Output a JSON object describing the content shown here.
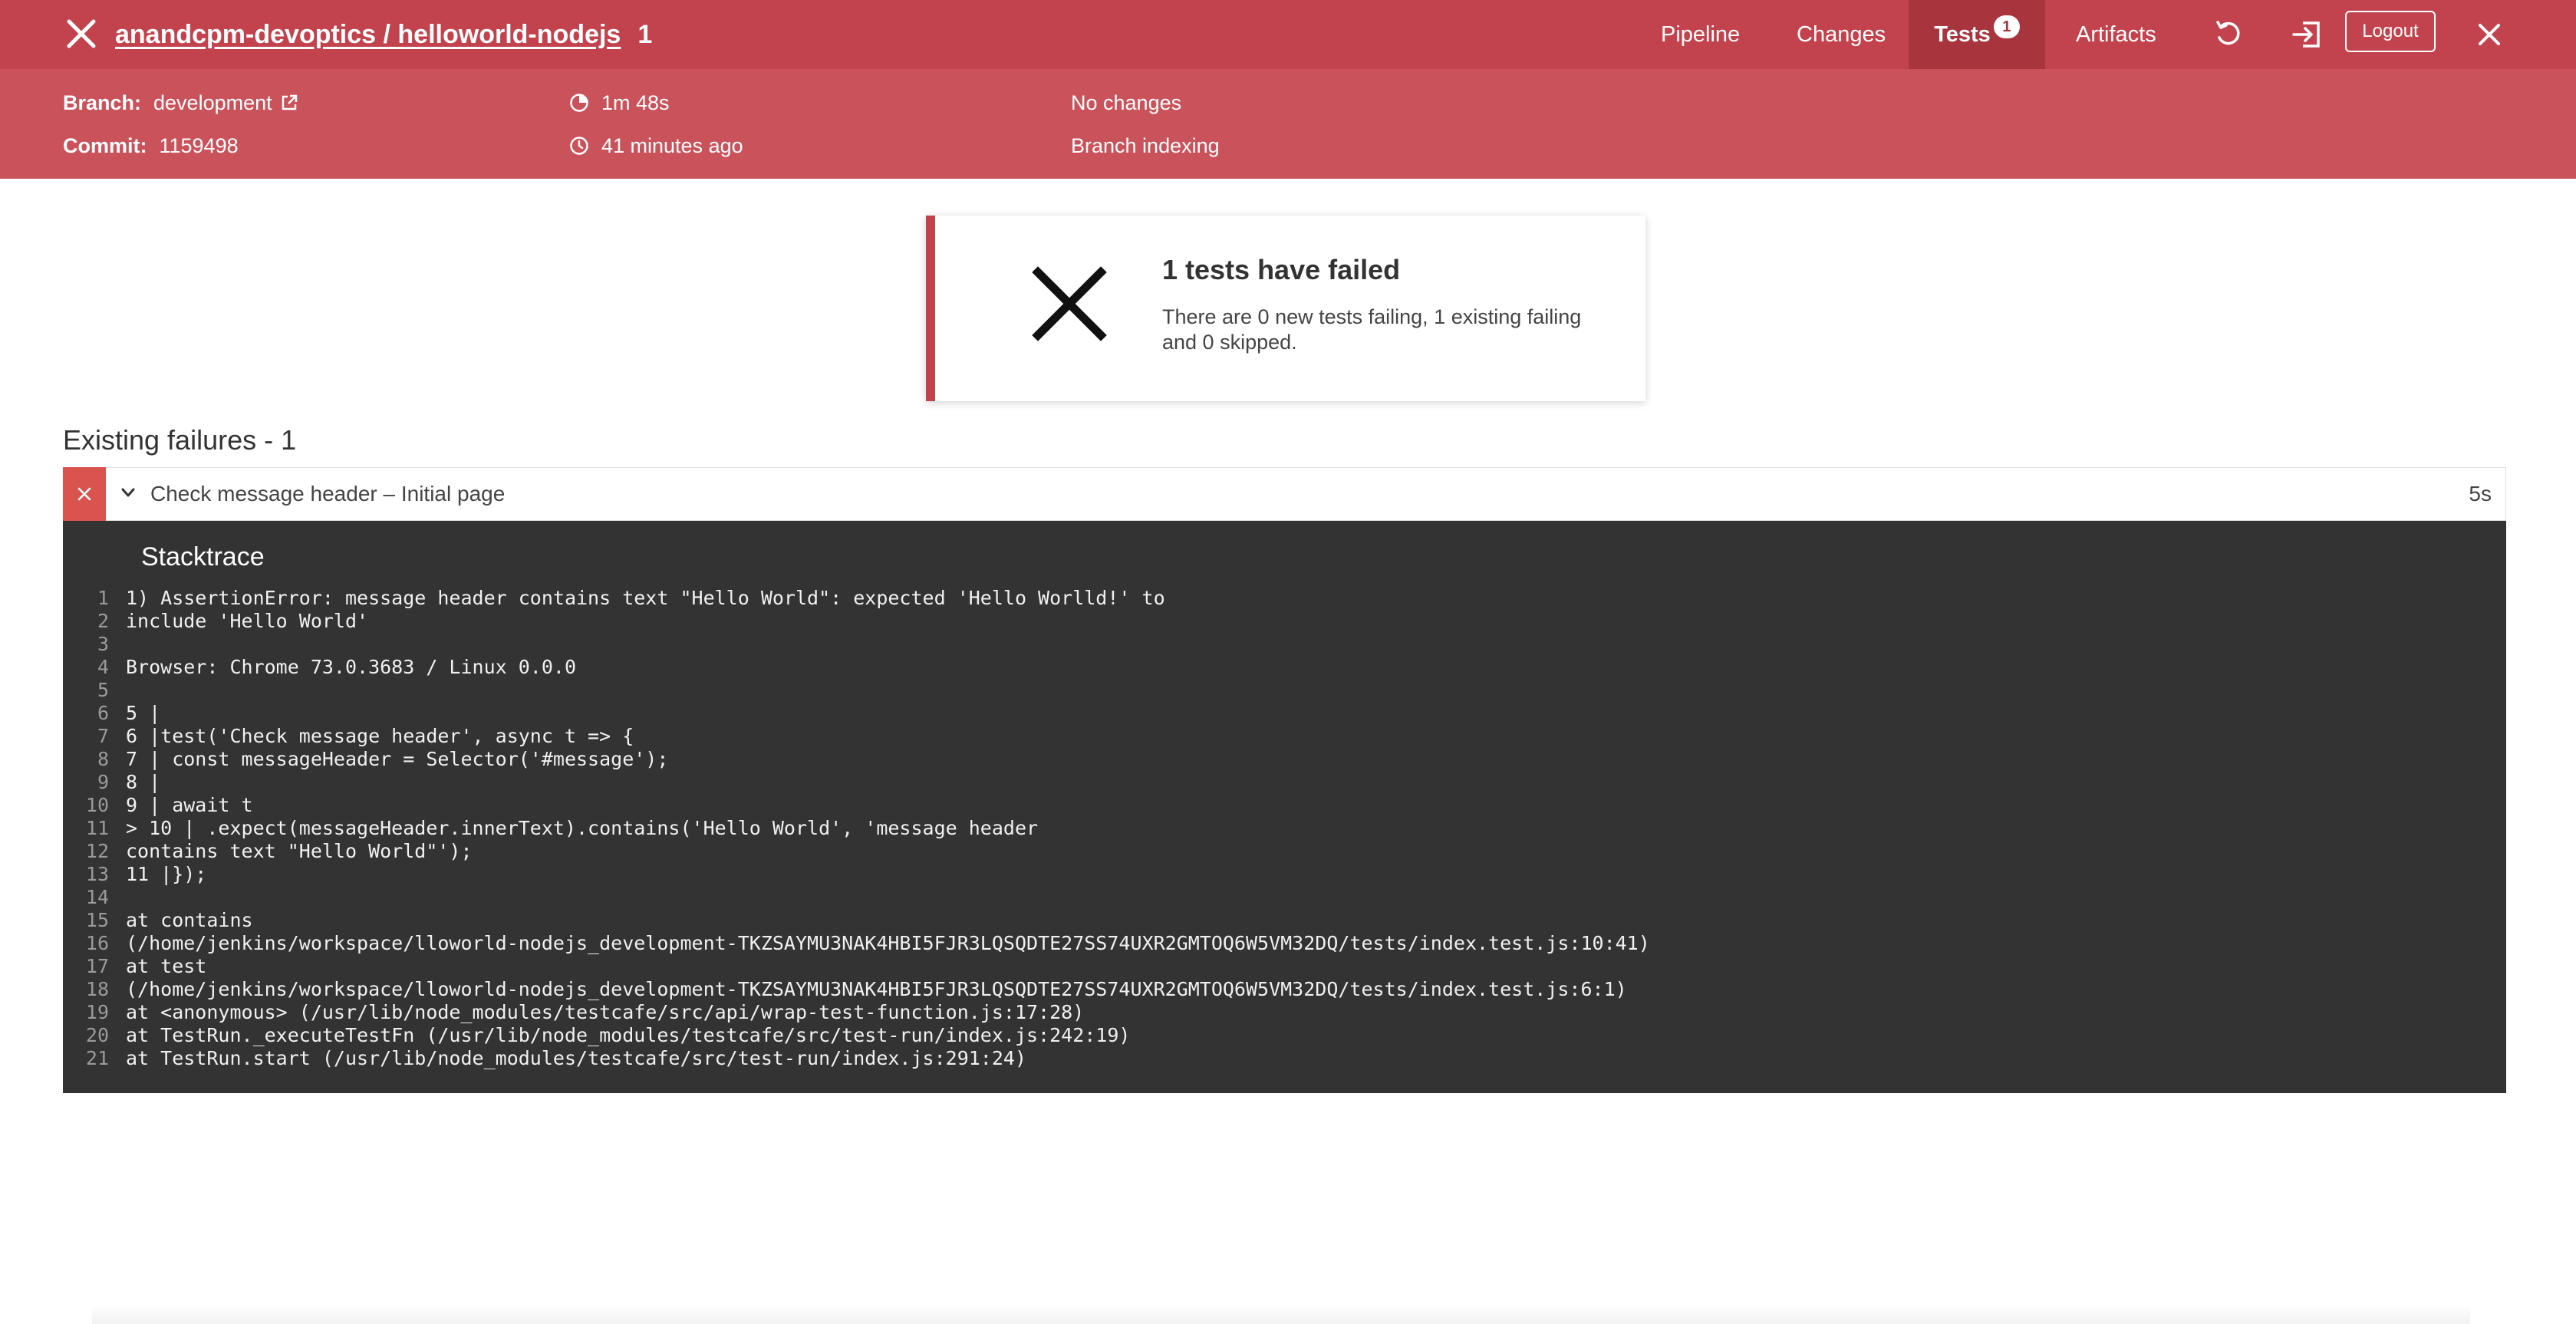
{
  "header": {
    "repo_path": "anandcpm-devoptics / helloworld-nodejs",
    "run_number": "1",
    "nav": {
      "pipeline": "Pipeline",
      "changes": "Changes",
      "tests": "Tests",
      "tests_badge": "1",
      "artifacts": "Artifacts",
      "logout": "Logout"
    }
  },
  "info": {
    "branch_label": "Branch:",
    "branch_value": "development",
    "commit_label": "Commit:",
    "commit_value": "1159498",
    "duration": "1m 48s",
    "time_ago": "41 minutes ago",
    "changes": "No changes",
    "cause": "Branch indexing"
  },
  "summary": {
    "title": "1 tests have failed",
    "text": "There are 0 new tests failing, 1 existing failing and 0 skipped."
  },
  "failures": {
    "section_title": "Existing failures - 1",
    "items": [
      {
        "name": "Check message header – Initial page",
        "duration": "5s"
      }
    ]
  },
  "stacktrace": {
    "title": "Stacktrace",
    "lines": [
      "1) AssertionError: message header contains text \"Hello World\": expected 'Hello Worlld!' to",
      "include 'Hello World'",
      "",
      "Browser: Chrome 73.0.3683 / Linux 0.0.0",
      "",
      "5 |",
      "6 |test('Check message header', async t => {",
      "7 | const messageHeader = Selector('#message');",
      "8 |",
      "9 | await t",
      "> 10 | .expect(messageHeader.innerText).contains('Hello World', 'message header",
      "contains text \"Hello World\"');",
      "11 |});",
      "",
      "at contains",
      "(/home/jenkins/workspace/lloworld-nodejs_development-TKZSAYMU3NAK4HBI5FJR3LQSQDTE27SS74UXR2GMTOQ6W5VM32DQ/tests/index.test.js:10:41)",
      "at test",
      "(/home/jenkins/workspace/lloworld-nodejs_development-TKZSAYMU3NAK4HBI5FJR3LQSQDTE27SS74UXR2GMTOQ6W5VM32DQ/tests/index.test.js:6:1)",
      "at <anonymous> (/usr/lib/node_modules/testcafe/src/api/wrap-test-function.js:17:28)",
      "at TestRun._executeTestFn (/usr/lib/node_modules/testcafe/src/test-run/index.js:242:19)",
      "at TestRun.start (/usr/lib/node_modules/testcafe/src/test-run/index.js:291:24)"
    ]
  },
  "colors": {
    "header_bg": "#c2434d",
    "infobar_bg": "#c9525b",
    "active_tab_bg": "#a8343d",
    "failure_red": "#d9534f",
    "stack_bg": "#333333"
  }
}
